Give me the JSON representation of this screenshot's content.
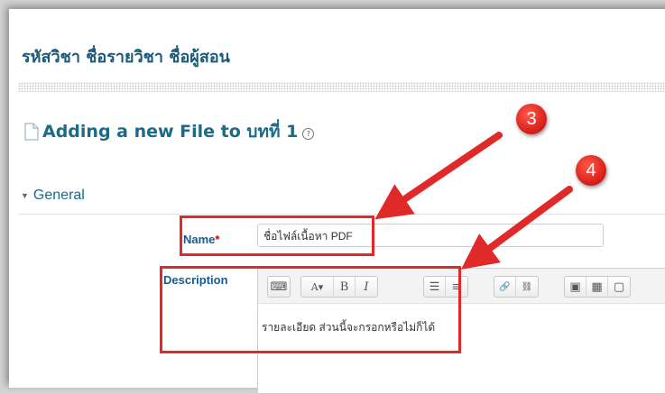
{
  "course": {
    "title": "รหัสวิชา ชื่อรายวิชา ชื่อผู้สอน"
  },
  "heading": {
    "text": "Adding a new File to บทที่ 1",
    "help_glyph": "?"
  },
  "section": {
    "label": "General",
    "caret": "▼"
  },
  "name_field": {
    "label": "Name",
    "required_mark": "*",
    "value": "ชื่อไฟล์เนื้อหา PDF"
  },
  "description_field": {
    "label": "Description",
    "text": "รายละเอียด ส่วนนี้จะกรอกหรือไม่ก็ได้",
    "toolbar": [
      {
        "name": "show-more-buttons",
        "glyph": "⌨"
      },
      {
        "name": "font-style",
        "glyph": "A▾"
      },
      {
        "name": "bold",
        "glyph": "B"
      },
      {
        "name": "italic",
        "glyph": "I"
      },
      {
        "name": "unordered-list",
        "glyph": "☰"
      },
      {
        "name": "ordered-list",
        "glyph": "≡"
      },
      {
        "name": "link",
        "glyph": "🔗"
      },
      {
        "name": "unlink",
        "glyph": "⛓"
      },
      {
        "name": "insert-image",
        "glyph": "▣"
      },
      {
        "name": "insert-media",
        "glyph": "▦"
      },
      {
        "name": "manage-files",
        "glyph": "▢"
      }
    ]
  },
  "annotations": {
    "badge_3": "3",
    "badge_4": "4"
  },
  "colors": {
    "annotation_red": "#e02a2a",
    "heading_blue": "#1a6a8a"
  }
}
